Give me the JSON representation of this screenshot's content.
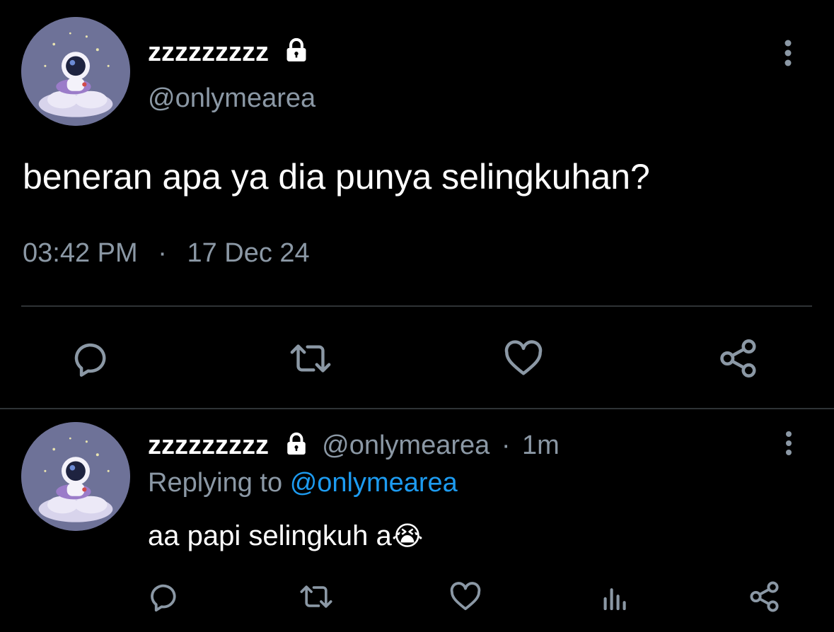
{
  "main_tweet": {
    "display_name": "zzzzzzzzz",
    "handle": "@onlymearea",
    "text": "beneran apa ya dia punya selingkuhan?",
    "time": "03:42 PM",
    "separator": "·",
    "date": "17 Dec 24",
    "icons": [
      "lock-icon",
      "more-vertical-icon",
      "reply-icon",
      "retweet-icon",
      "like-icon",
      "share-icon"
    ]
  },
  "reply_tweet": {
    "display_name": "zzzzzzzzz",
    "handle": "@onlymearea",
    "meta_separator": "·",
    "age": "1m",
    "replying_prefix": "Replying to",
    "replying_handle": "@onlymearea",
    "text": "aa papi selingkuh a",
    "emoji": "😭",
    "icons": [
      "lock-icon",
      "more-vertical-icon",
      "reply-icon",
      "retweet-icon",
      "like-icon",
      "views-icon",
      "share-icon"
    ]
  },
  "colors": {
    "background": "#000000",
    "text_primary": "#ffffff",
    "text_secondary": "#8b98a5",
    "accent": "#1d9bf0",
    "divider": "#2f3336"
  }
}
